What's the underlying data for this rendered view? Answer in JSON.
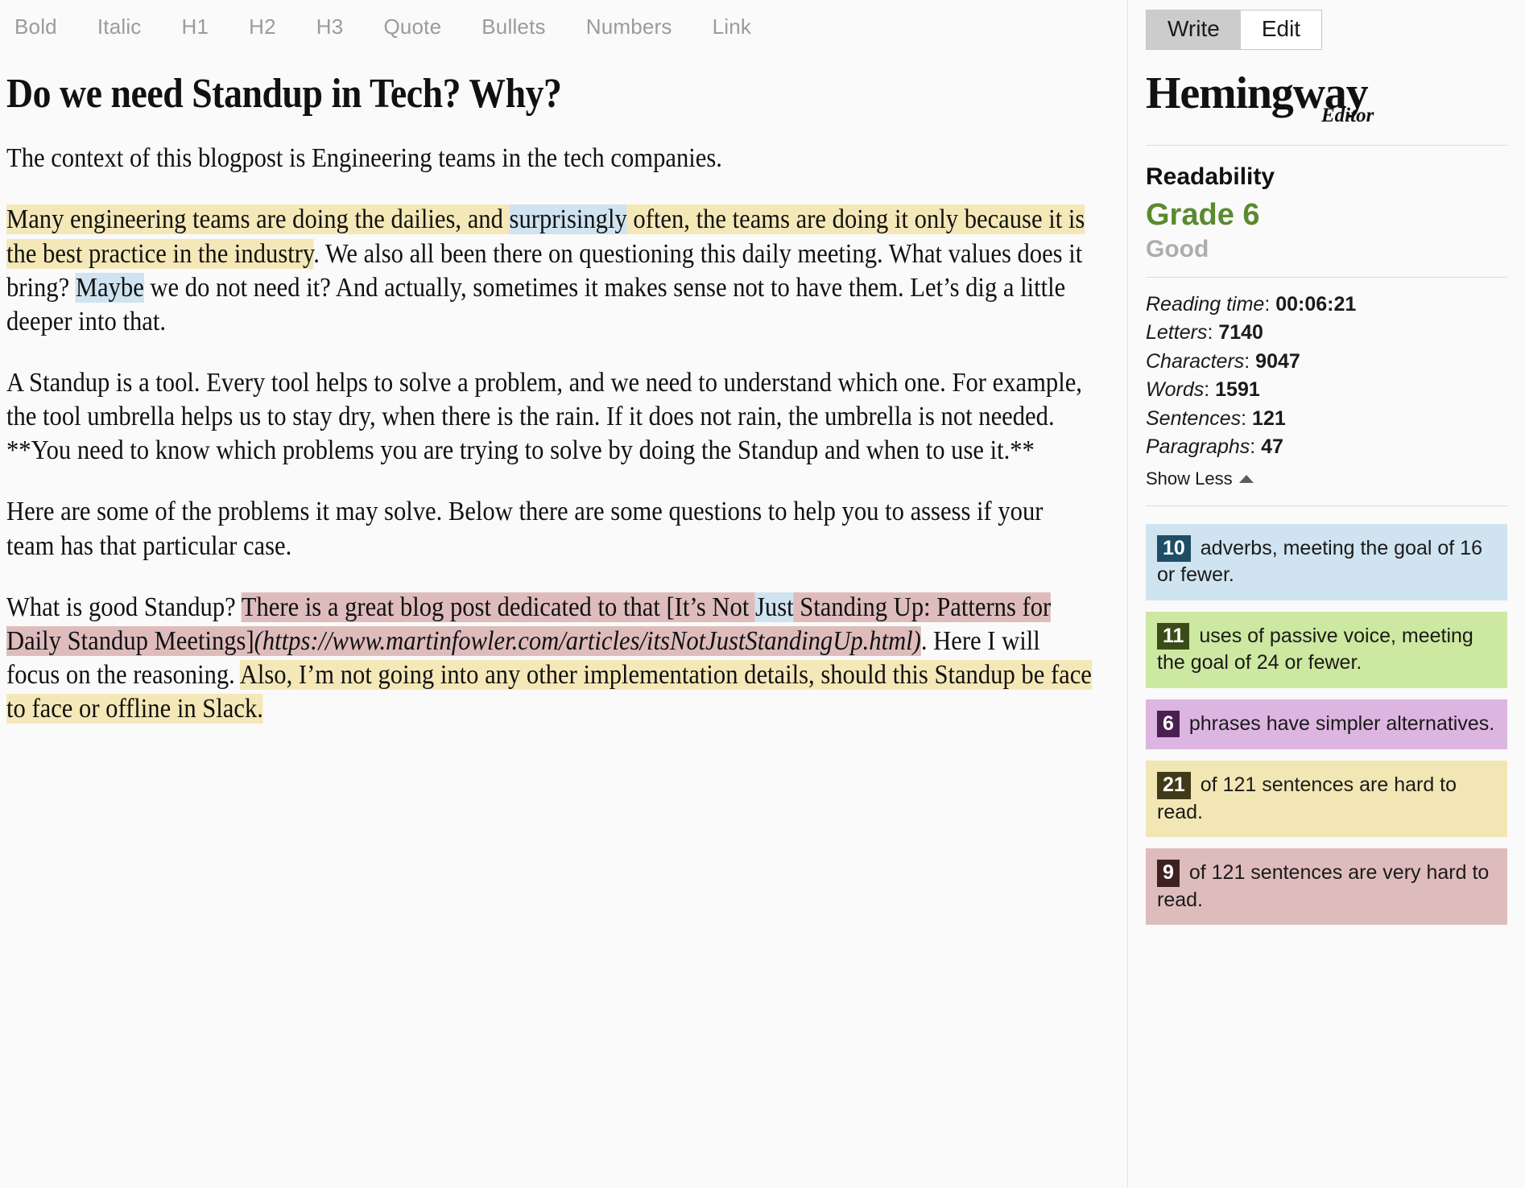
{
  "toolbar": {
    "items": [
      {
        "label": "Bold",
        "name": "toolbar-bold"
      },
      {
        "label": "Italic",
        "name": "toolbar-italic"
      },
      {
        "label": "H1",
        "name": "toolbar-h1"
      },
      {
        "label": "H2",
        "name": "toolbar-h2"
      },
      {
        "label": "H3",
        "name": "toolbar-h3"
      },
      {
        "label": "Quote",
        "name": "toolbar-quote"
      },
      {
        "label": "Bullets",
        "name": "toolbar-bullets"
      },
      {
        "label": "Numbers",
        "name": "toolbar-numbers"
      },
      {
        "label": "Link",
        "name": "toolbar-link"
      }
    ]
  },
  "document": {
    "title": "Do we need Standup in Tech? Why?",
    "paragraphs": {
      "p1": "The context of this blogpost is Engineering teams in the tech companies.",
      "p2_a": "Many engineering teams are doing the dailies, and ",
      "p2_b": "surprisingly",
      "p2_c": " often, the teams are doing it only because it is the best practice in the industry",
      "p2_d": ". We also all been there on questioning this daily meeting. What values does it bring? ",
      "p2_e": "Maybe",
      "p2_f": " we do not need it? And actually, sometimes it makes sense not to have them. Let’s dig a little deeper into that.",
      "p3": "A Standup is a tool. Every tool helps to solve a problem, and we need to understand which one. For example, the tool umbrella helps us to stay dry, when there is the rain. If it does not rain, the umbrella is not needed. **You need to know which problems you are trying to solve by doing the Standup and when to use it.**",
      "p4": "Here are some of the problems it may solve. Below there are some questions to help you to assess if your team has that particular case.",
      "p5_a": "What is good Standup? ",
      "p5_b": "There is a great blog post dedicated to that [It’s Not ",
      "p5_c": "Just",
      "p5_d": " Standing Up: Patterns for Daily Standup Meetings]",
      "p5_e": "(https://www.martinfowler.com/articles/itsNotJustStandingUp.html)",
      "p5_f": ". Here I will focus on the reasoning. ",
      "p5_g": "Also, I’m not going into any other implementation details, should this Standup be face to face or offline in Slack",
      "p5_h": "."
    }
  },
  "sidebar": {
    "mode": {
      "write_label": "Write",
      "edit_label": "Edit",
      "active": "Write"
    },
    "brand": {
      "name": "Hemingway",
      "subtitle": "Editor"
    },
    "readability": {
      "heading": "Readability",
      "grade": "Grade 6",
      "grade_color": "#5a8a2e",
      "description": "Good"
    },
    "stats": [
      {
        "label": "Reading time",
        "value": "00:06:21",
        "name": "stat-reading-time"
      },
      {
        "label": "Letters",
        "value": "7140",
        "name": "stat-letters"
      },
      {
        "label": "Characters",
        "value": "9047",
        "name": "stat-characters"
      },
      {
        "label": "Words",
        "value": "1591",
        "name": "stat-words"
      },
      {
        "label": "Sentences",
        "value": "121",
        "name": "stat-sentences"
      },
      {
        "label": "Paragraphs",
        "value": "47",
        "name": "stat-paragraphs"
      }
    ],
    "show_less_label": "Show Less",
    "callouts": [
      {
        "name": "callout-adverbs",
        "count": "10",
        "text": " adverbs, meeting the goal of 16 or fewer.",
        "bg": "#cfe3f0",
        "badge_bg": "#1e4d66"
      },
      {
        "name": "callout-passive-voice",
        "count": "11",
        "text": " uses of passive voice, meeting the goal of 24 or fewer.",
        "bg": "#cde8a0",
        "badge_bg": "#3a4d18"
      },
      {
        "name": "callout-simpler-alternatives",
        "count": "6",
        "text": " phrases have simpler alternatives.",
        "bg": "#dcb5e0",
        "badge_bg": "#4a2050"
      },
      {
        "name": "callout-hard-to-read",
        "count": "21",
        "text": " of 121 sentences are hard to read.",
        "bg": "#f2e6b4",
        "badge_bg": "#403a18"
      },
      {
        "name": "callout-very-hard-to-read",
        "count": "9",
        "text": " of 121 sentences are very hard to read.",
        "bg": "#dfbcbc",
        "badge_bg": "#3d2020"
      }
    ]
  }
}
